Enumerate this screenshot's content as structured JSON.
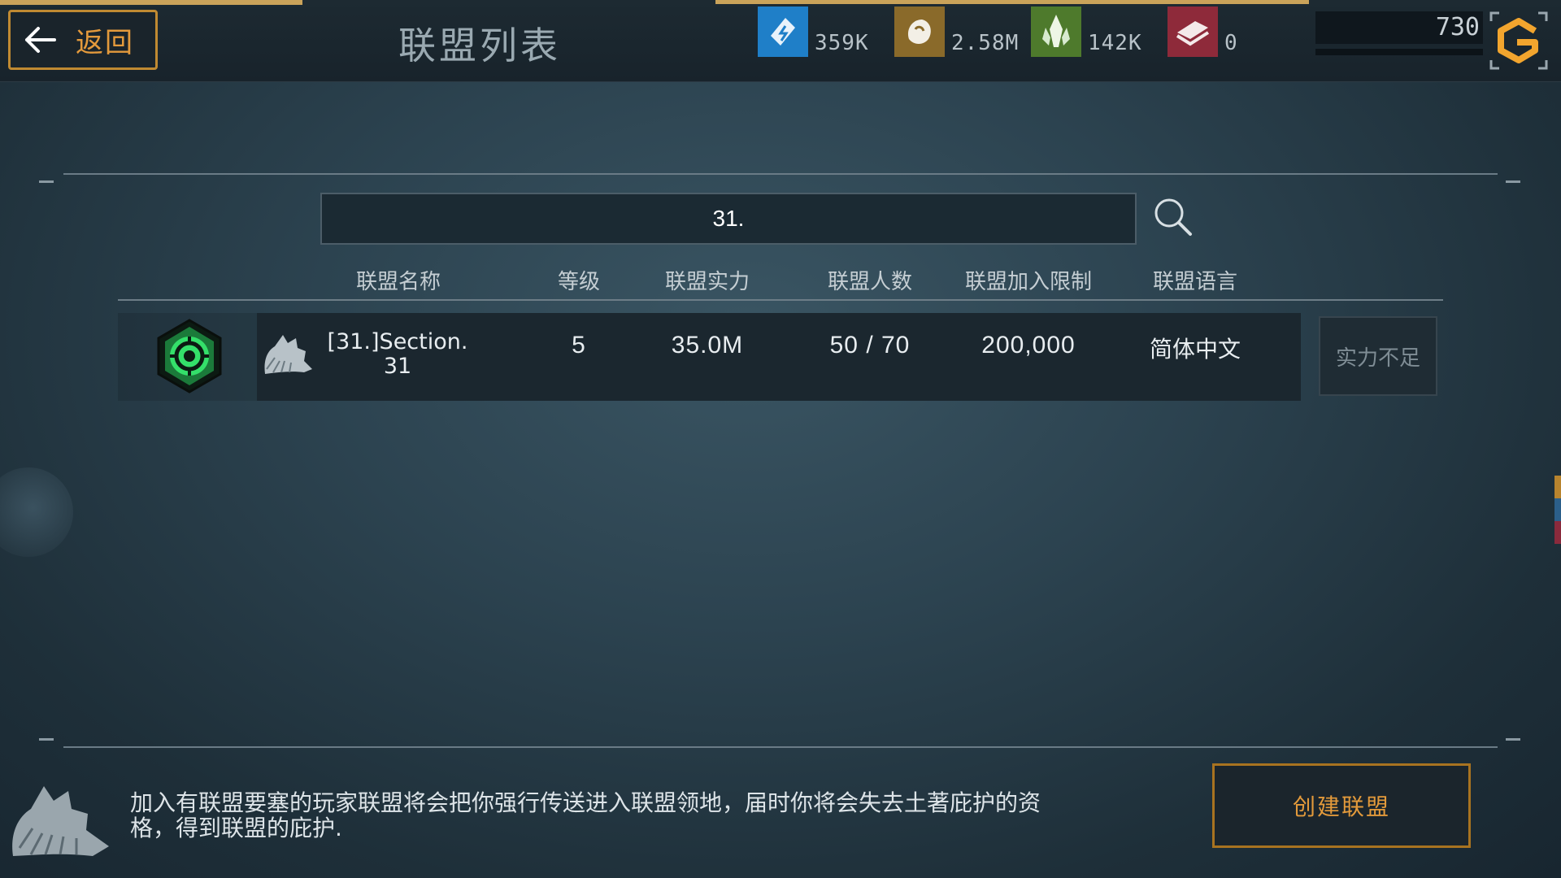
{
  "header": {
    "back_label": "返回",
    "title": "联盟列表",
    "resources": [
      {
        "icon": "energy-icon",
        "value": "359K",
        "color": "#1f7fc8"
      },
      {
        "icon": "ore-icon",
        "value": "2.58M",
        "color": "#8a6a2a"
      },
      {
        "icon": "crystal-icon",
        "value": "142K",
        "color": "#4e7a2c"
      },
      {
        "icon": "alloy-icon",
        "value": "0",
        "color": "#8e2a3a"
      }
    ],
    "power_value": "730"
  },
  "search": {
    "value": "31."
  },
  "table": {
    "columns": [
      "联盟名称",
      "等级",
      "联盟实力",
      "联盟人数",
      "联盟加入限制",
      "联盟语言"
    ],
    "rows": [
      {
        "name_line1": "[31.]Section.",
        "name_line2": "31",
        "level": "5",
        "strength": "35.0M",
        "members": "50 / 70",
        "join_limit": "200,000",
        "language": "简体中文",
        "action_label": "实力不足"
      }
    ]
  },
  "footer": {
    "notice": "加入有联盟要塞的玩家联盟将会把你强行传送进入联盟领地，届时你将会失去土著庇护的资格，得到联盟的庇护.",
    "create_label": "创建联盟"
  },
  "colors": {
    "accent_orange": "#e49a3c",
    "emblem_green": "#34e06a"
  }
}
